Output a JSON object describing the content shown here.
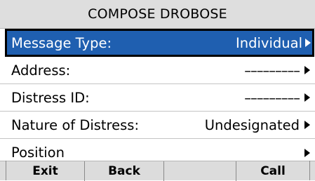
{
  "title": "COMPOSE DROBOSE",
  "menu": {
    "items": [
      {
        "label": "Message Type:",
        "value": "Individual"
      },
      {
        "label": "Address:",
        "value": "–––––––––"
      },
      {
        "label": "Distress ID:",
        "value": "–––––––––"
      },
      {
        "label": "Nature of Distress:",
        "value": "Undesignated"
      },
      {
        "label": "Position",
        "value": ""
      }
    ]
  },
  "softkeys": {
    "exit": "Exit",
    "back": "Back",
    "empty": "",
    "call": "Call"
  },
  "colors": {
    "selection": "#1f5fb0",
    "title_bar": "#dedede",
    "softkey_bar": "#dcdcdc"
  },
  "icons": [
    "right-arrow-icon"
  ]
}
